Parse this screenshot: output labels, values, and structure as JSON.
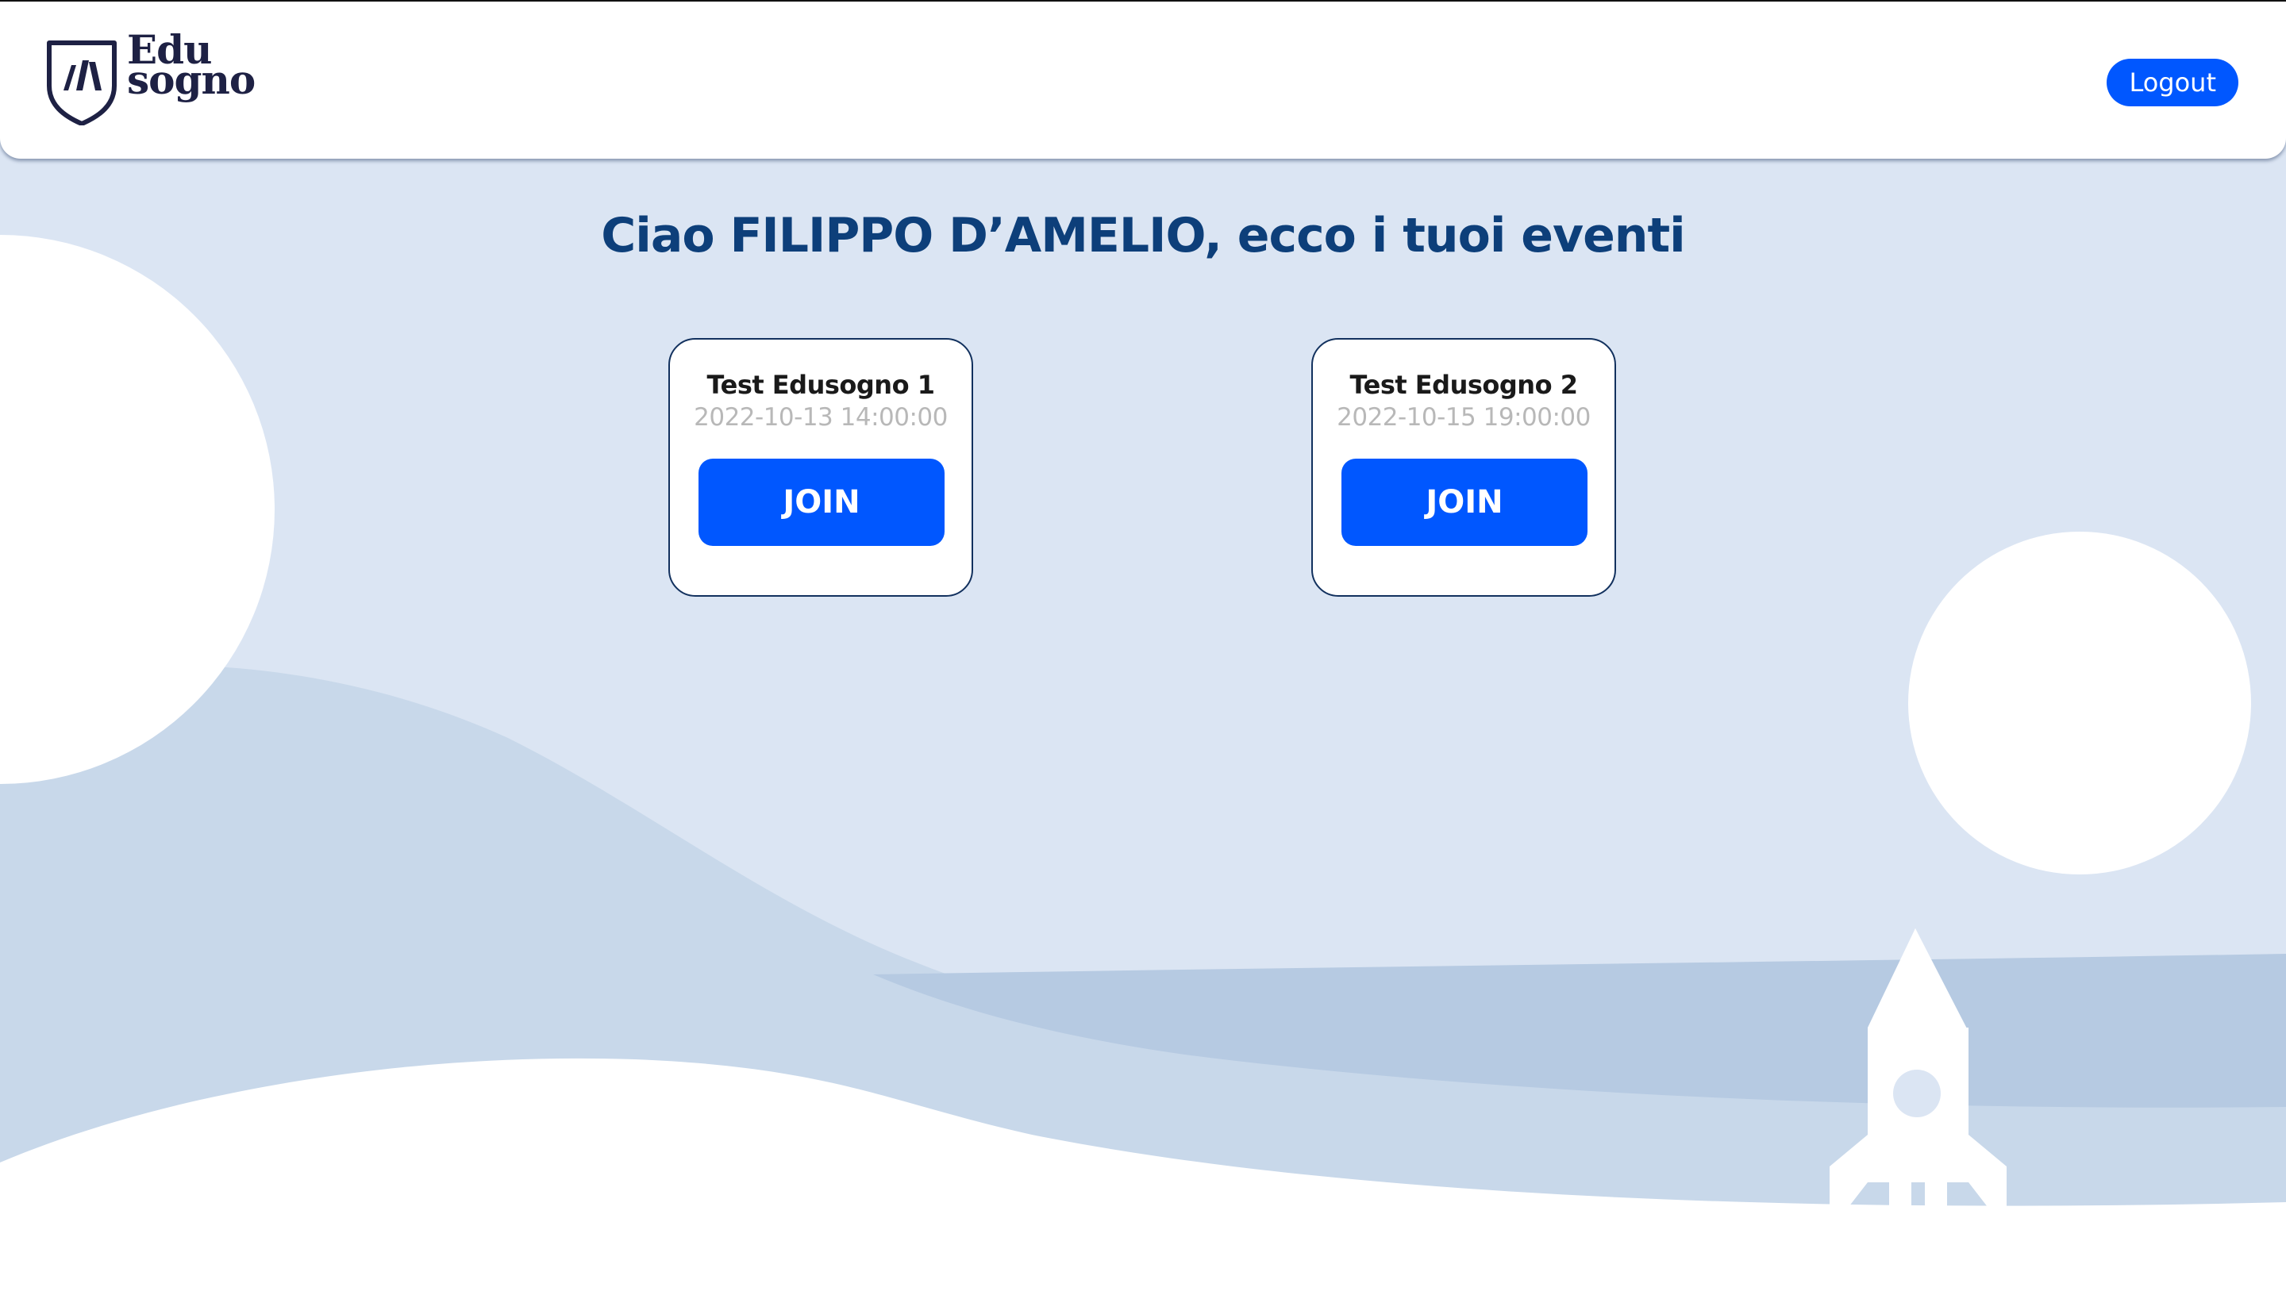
{
  "header": {
    "logo_line1": "Edu",
    "logo_line2": "sogno",
    "logout_label": "Logout"
  },
  "main": {
    "greeting": "Ciao FILIPPO D’AMELIO, ecco i tuoi eventi",
    "events": [
      {
        "title": "Test Edusogno 1",
        "date": "2022-10-13 14:00:00",
        "button_label": "JOIN"
      },
      {
        "title": "Test Edusogno 2",
        "date": "2022-10-15 19:00:00",
        "button_label": "JOIN"
      }
    ]
  },
  "colors": {
    "accent": "#0057ff",
    "heading": "#0d3f7a",
    "background": "#dbe5f3",
    "logo": "#1e2144"
  },
  "icons": {
    "logo": "edusogno-shield-logo-icon",
    "decoration": "rocket-icon"
  }
}
